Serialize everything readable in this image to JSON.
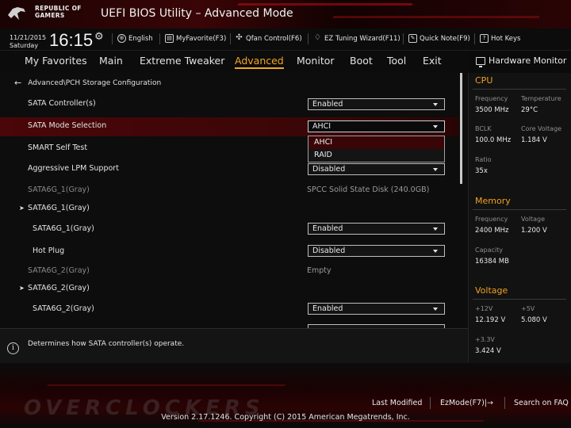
{
  "header": {
    "brand_line1": "REPUBLIC OF",
    "brand_line2": "GAMERS",
    "title": "UEFI BIOS Utility – Advanced Mode"
  },
  "infobar": {
    "date": "11/21/2015",
    "day": "Saturday",
    "time": "16:15",
    "items": [
      {
        "label": "English",
        "icon": "globe-icon"
      },
      {
        "label": "MyFavorite(F3)",
        "icon": "favorite-icon"
      },
      {
        "label": "Qfan Control(F6)",
        "icon": "fan-icon"
      },
      {
        "label": "EZ Tuning Wizard(F11)",
        "icon": "bulb-icon"
      },
      {
        "label": "Quick Note(F9)",
        "icon": "note-icon"
      },
      {
        "label": "Hot Keys",
        "icon": "help-icon"
      }
    ]
  },
  "tabs": [
    {
      "label": "My Favorites",
      "active": false
    },
    {
      "label": "Main",
      "active": false
    },
    {
      "label": "Extreme Tweaker",
      "active": false
    },
    {
      "label": "Advanced",
      "active": true
    },
    {
      "label": "Monitor",
      "active": false
    },
    {
      "label": "Boot",
      "active": false
    },
    {
      "label": "Tool",
      "active": false
    },
    {
      "label": "Exit",
      "active": false
    }
  ],
  "breadcrumb": "Advanced\\PCH Storage Configuration",
  "settings": [
    {
      "label": "SATA Controller(s)",
      "value": "Enabled",
      "type": "select"
    },
    {
      "label": "SATA Mode Selection",
      "value": "AHCI",
      "type": "select"
    },
    {
      "label": "SMART Self Test",
      "value": "",
      "type": "select"
    },
    {
      "label": "Aggressive LPM Support",
      "value": "Disabled",
      "type": "select"
    },
    {
      "label": "SATA6G_1(Gray)",
      "value": "SPCC Solid State Disk (240.0GB)",
      "type": "text"
    },
    {
      "label": "SATA6G_1(Gray)",
      "value": "",
      "type": "group"
    },
    {
      "label": "SATA6G_1(Gray)",
      "value": "Enabled",
      "type": "select"
    },
    {
      "label": "Hot Plug",
      "value": "Disabled",
      "type": "select"
    },
    {
      "label": "SATA6G_2(Gray)",
      "value": "Empty",
      "type": "text"
    },
    {
      "label": "SATA6G_2(Gray)",
      "value": "",
      "type": "group"
    },
    {
      "label": "SATA6G_2(Gray)",
      "value": "Enabled",
      "type": "select"
    }
  ],
  "dropdown": {
    "options": [
      "AHCI",
      "RAID"
    ],
    "selected": "AHCI"
  },
  "help": {
    "text": "Determines how SATA controller(s) operate."
  },
  "hardware_monitor": {
    "title": "Hardware Monitor",
    "cpu": {
      "title": "CPU",
      "frequency_label": "Frequency",
      "frequency": "3500 MHz",
      "temperature_label": "Temperature",
      "temperature": "29°C",
      "bclk_label": "BCLK",
      "bclk": "100.0 MHz",
      "core_voltage_label": "Core Voltage",
      "core_voltage": "1.184 V",
      "ratio_label": "Ratio",
      "ratio": "35x"
    },
    "memory": {
      "title": "Memory",
      "frequency_label": "Frequency",
      "frequency": "2400 MHz",
      "voltage_label": "Voltage",
      "voltage": "1.200 V",
      "capacity_label": "Capacity",
      "capacity": "16384 MB"
    },
    "voltage": {
      "title": "Voltage",
      "v12_label": "+12V",
      "v12": "12.192 V",
      "v5_label": "+5V",
      "v5": "5.080 V",
      "v33_label": "+3.3V",
      "v33": "3.424 V"
    }
  },
  "footer": {
    "last_modified": "Last Modified",
    "ezmode": "EzMode(F7)|→",
    "search": "Search on FAQ",
    "version": "Version 2.17.1246. Copyright (C) 2015 American Megatrends, Inc."
  },
  "colors": {
    "accent": "#f5a623",
    "highlight": "#4a0608",
    "brand_red": "#b10e16"
  }
}
